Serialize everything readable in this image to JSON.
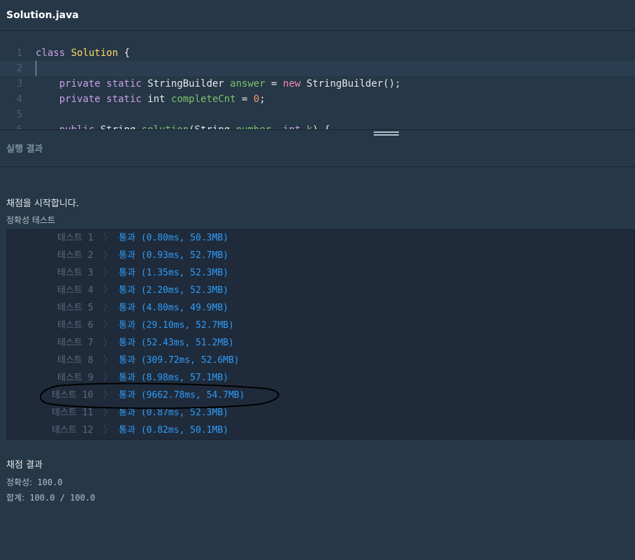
{
  "file": {
    "title": "Solution.java"
  },
  "editor": {
    "lines": [
      {
        "num": "1",
        "tokens": [
          [
            "kw",
            "class"
          ],
          [
            "plain",
            " "
          ],
          [
            "cls",
            "Solution"
          ],
          [
            "plain",
            " {"
          ]
        ]
      },
      {
        "num": "2",
        "tokens": []
      },
      {
        "num": "3",
        "tokens": [
          [
            "plain",
            "    "
          ],
          [
            "kw",
            "private static"
          ],
          [
            "plain",
            " StringBuilder "
          ],
          [
            "var",
            "answer"
          ],
          [
            "plain",
            " = "
          ],
          [
            "new",
            "new"
          ],
          [
            "plain",
            " StringBuilder();"
          ]
        ]
      },
      {
        "num": "4",
        "tokens": [
          [
            "plain",
            "    "
          ],
          [
            "kw",
            "private static"
          ],
          [
            "plain",
            " int "
          ],
          [
            "var",
            "completeCnt"
          ],
          [
            "plain",
            " = "
          ],
          [
            "num",
            "0"
          ],
          [
            "plain",
            ";"
          ]
        ]
      },
      {
        "num": "5",
        "tokens": []
      },
      {
        "num": "6",
        "tokens": [
          [
            "plain",
            "    "
          ],
          [
            "kw",
            "public"
          ],
          [
            "plain",
            " String "
          ],
          [
            "var",
            "solution"
          ],
          [
            "plain",
            "(String "
          ],
          [
            "var",
            "number"
          ],
          [
            "plain",
            ", "
          ],
          [
            "kw",
            "int"
          ],
          [
            "plain",
            " "
          ],
          [
            "var",
            "k"
          ],
          [
            "plain",
            ") {"
          ]
        ]
      }
    ]
  },
  "result": {
    "title": "실행 결과",
    "start_message": "채점을 시작합니다.",
    "section_label": "정확성  테스트",
    "tests": [
      {
        "name": "테스트 1",
        "result": "통과 (0.80ms, 50.3MB)"
      },
      {
        "name": "테스트 2",
        "result": "통과 (0.93ms, 52.7MB)"
      },
      {
        "name": "테스트 3",
        "result": "통과 (1.35ms, 52.3MB)"
      },
      {
        "name": "테스트 4",
        "result": "통과 (2.20ms, 52.3MB)"
      },
      {
        "name": "테스트 5",
        "result": "통과 (4.80ms, 49.9MB)"
      },
      {
        "name": "테스트 6",
        "result": "통과 (29.10ms, 52.7MB)"
      },
      {
        "name": "테스트 7",
        "result": "통과 (52.43ms, 51.2MB)"
      },
      {
        "name": "테스트 8",
        "result": "통과 (309.72ms, 52.6MB)"
      },
      {
        "name": "테스트 9",
        "result": "통과 (8.98ms, 57.1MB)"
      },
      {
        "name": "테스트 10",
        "result": "통과 (9662.78ms, 54.7MB)"
      },
      {
        "name": "테스트 11",
        "result": "통과 (0.87ms, 52.3MB)"
      },
      {
        "name": "테스트 12",
        "result": "통과 (0.82ms, 50.1MB)"
      }
    ],
    "arrow": "〉",
    "grade": {
      "title": "채점 결과",
      "accuracy_label": "정확성:",
      "accuracy_value": "100.0",
      "total_label": "합계:",
      "total_value": "100.0 / 100.0"
    }
  },
  "colors": {
    "background": "#263747",
    "pass": "#2f9cf7",
    "annotation": "#000000"
  }
}
